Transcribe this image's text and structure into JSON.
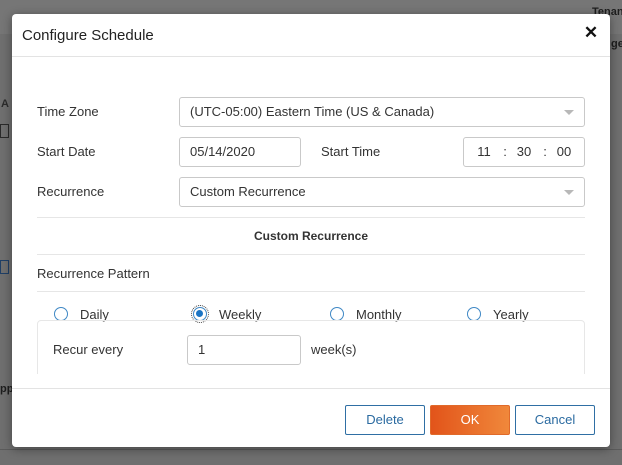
{
  "background": {
    "header_right_text": "Tenan",
    "header_right_text2": "ge",
    "left_letter": "A",
    "left_letter2": "pp"
  },
  "dialog": {
    "title": "Configure Schedule",
    "close_symbol": "✕"
  },
  "form": {
    "time_zone_label": "Time Zone",
    "time_zone_value": "(UTC-05:00) Eastern Time (US & Canada)",
    "start_date_label": "Start Date",
    "start_date_value": "05/14/2020",
    "start_time_label": "Start Time",
    "start_time": {
      "hour": "11",
      "minute": "30",
      "second": "00",
      "separator": ":"
    },
    "recurrence_label": "Recurrence",
    "recurrence_value": "Custom Recurrence"
  },
  "custom_recurrence": {
    "section_title": "Custom Recurrence",
    "pattern_label": "Recurrence Pattern",
    "options": [
      {
        "label": "Daily",
        "checked": false
      },
      {
        "label": "Weekly",
        "checked": true
      },
      {
        "label": "Monthly",
        "checked": false
      },
      {
        "label": "Yearly",
        "checked": false
      }
    ],
    "recur_every_label": "Recur every",
    "recur_every_value": "1",
    "recur_every_unit": "week(s)"
  },
  "footer": {
    "delete_label": "Delete",
    "ok_label": "OK",
    "cancel_label": "Cancel"
  },
  "colors": {
    "primary_gradient_start": "#e2541a",
    "primary_gradient_end": "#f0883b",
    "outline_button": "#2f6fa4",
    "radio_checked": "#1a74c4"
  }
}
